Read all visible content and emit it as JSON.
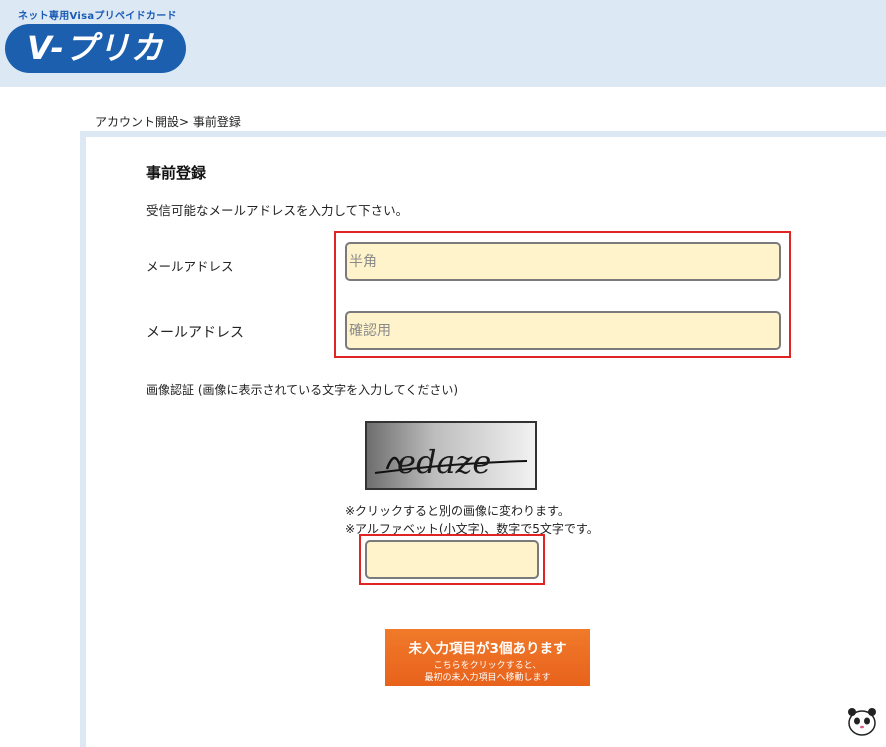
{
  "header": {
    "tagline": "ネット専用Visaプリペイドカード",
    "logo_text": "V-プリカ"
  },
  "breadcrumb": "アカウント開設> 事前登録",
  "form": {
    "title": "事前登録",
    "instruction": "受信可能なメールアドレスを入力して下さい。",
    "email_label": "メールアドレス",
    "email_placeholder": "半角",
    "email_confirm_label": "メールアドレス",
    "email_confirm_placeholder": "確認用",
    "captcha_label": "画像認証 (画像に表示されている文字を入力してください)",
    "captcha_text": "edaze",
    "captcha_note1": "※クリックすると別の画像に変わります。",
    "captcha_note2": "※アルファベット(小文字)、数字で5文字です。",
    "captcha_value": ""
  },
  "submit": {
    "main": "未入力項目が3個あります",
    "sub1": "こちらをクリックすると、",
    "sub2": "最初の未入力項目へ移動します"
  },
  "icons": {
    "mascot": "panda-mascot-icon"
  },
  "colors": {
    "brand_blue": "#1b5fae",
    "header_bg": "#dce8f4",
    "highlight_red": "#e02424",
    "field_bg": "#fff3cc",
    "button_orange": "#f07a2a"
  }
}
